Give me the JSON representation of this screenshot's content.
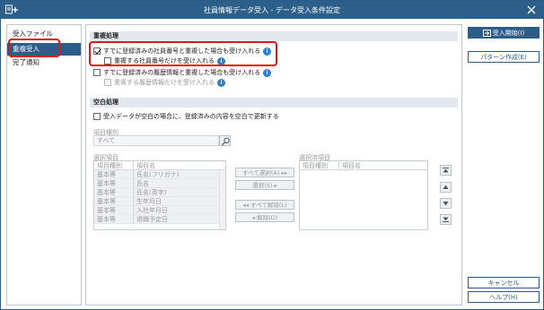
{
  "window": {
    "title": "社員情報データ受入 - データ受入条件設定"
  },
  "sidebar": {
    "items": [
      {
        "label": "受入ファイル"
      },
      {
        "label": "重複受入"
      },
      {
        "label": "完了通知"
      }
    ]
  },
  "duplicate": {
    "header": "重複処理",
    "opt1": "すでに登録済みの社員番号と重複した場合も受け入れる",
    "opt1_sub": "重複する社員番号だけを受け入れる",
    "opt2": "すでに登録済みの履歴情報と重複した場合も受け入れる",
    "opt2_sub": "重複する履歴情報だけを受け入れる"
  },
  "blank": {
    "header": "空白処理",
    "opt": "受入データが空白の場合に、登録済みの内容を空白で更新する"
  },
  "item_kind": {
    "label": "項目種別",
    "value": "すべて"
  },
  "selection": {
    "left_label": "選択項目",
    "right_label": "選択済項目",
    "col_kind": "項目種別",
    "col_name": "項目名",
    "rows": [
      {
        "kind": "基本等",
        "name": "氏名(フリガナ)"
      },
      {
        "kind": "基本等",
        "name": "氏名"
      },
      {
        "kind": "基本等",
        "name": "氏名(英字)"
      },
      {
        "kind": "基本等",
        "name": "生年月日"
      },
      {
        "kind": "基本等",
        "name": "入社年月日"
      },
      {
        "kind": "基本等",
        "name": "退職予定日"
      }
    ],
    "btn_select_all": "すべて選択(A)",
    "btn_select": "選択(S)",
    "btn_clear_all": "すべて解除(L)",
    "btn_clear": "解除(D)"
  },
  "right": {
    "start": "受入開始(I)",
    "pattern": "パターン作成(E)",
    "cancel": "キャンセル",
    "help": "ヘルプ(H)"
  }
}
